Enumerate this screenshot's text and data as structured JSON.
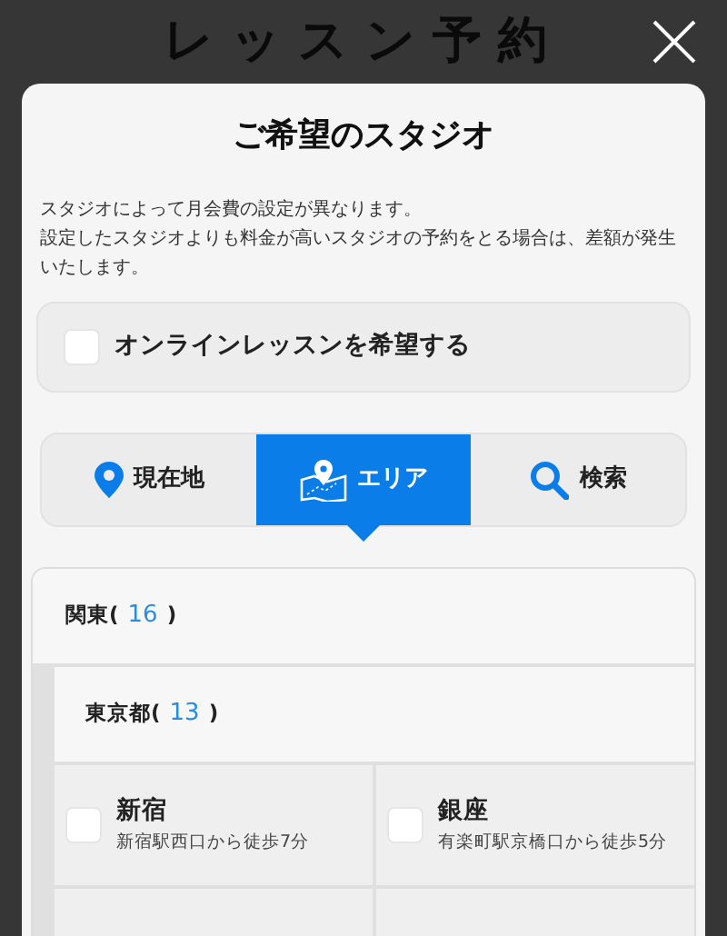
{
  "page_title": "レッスン予約",
  "modal": {
    "title": "ご希望のスタジオ",
    "notes": [
      "スタジオによって月会費の設定が異なります。",
      "設定したスタジオよりも料金が高いスタジオの予約をとる場合は、差額が発生いたします。"
    ],
    "online_option": {
      "label": "オンラインレッスンを希望する",
      "checked": false
    },
    "tabs": [
      {
        "label": "現在地",
        "selected": false
      },
      {
        "label": "エリア",
        "selected": true
      },
      {
        "label": "検索",
        "selected": false
      }
    ],
    "regions": [
      {
        "name": "関東(",
        "count": "16",
        "close": ")",
        "children": [
          {
            "name": "東京都(",
            "count": "13",
            "close": ")",
            "studios": [
              {
                "name": "新宿",
                "access": "新宿駅西口から徒歩7分",
                "checked": false
              },
              {
                "name": "銀座",
                "access": "有楽町駅京橋口から徒歩5分",
                "checked": false
              }
            ]
          }
        ]
      }
    ]
  }
}
